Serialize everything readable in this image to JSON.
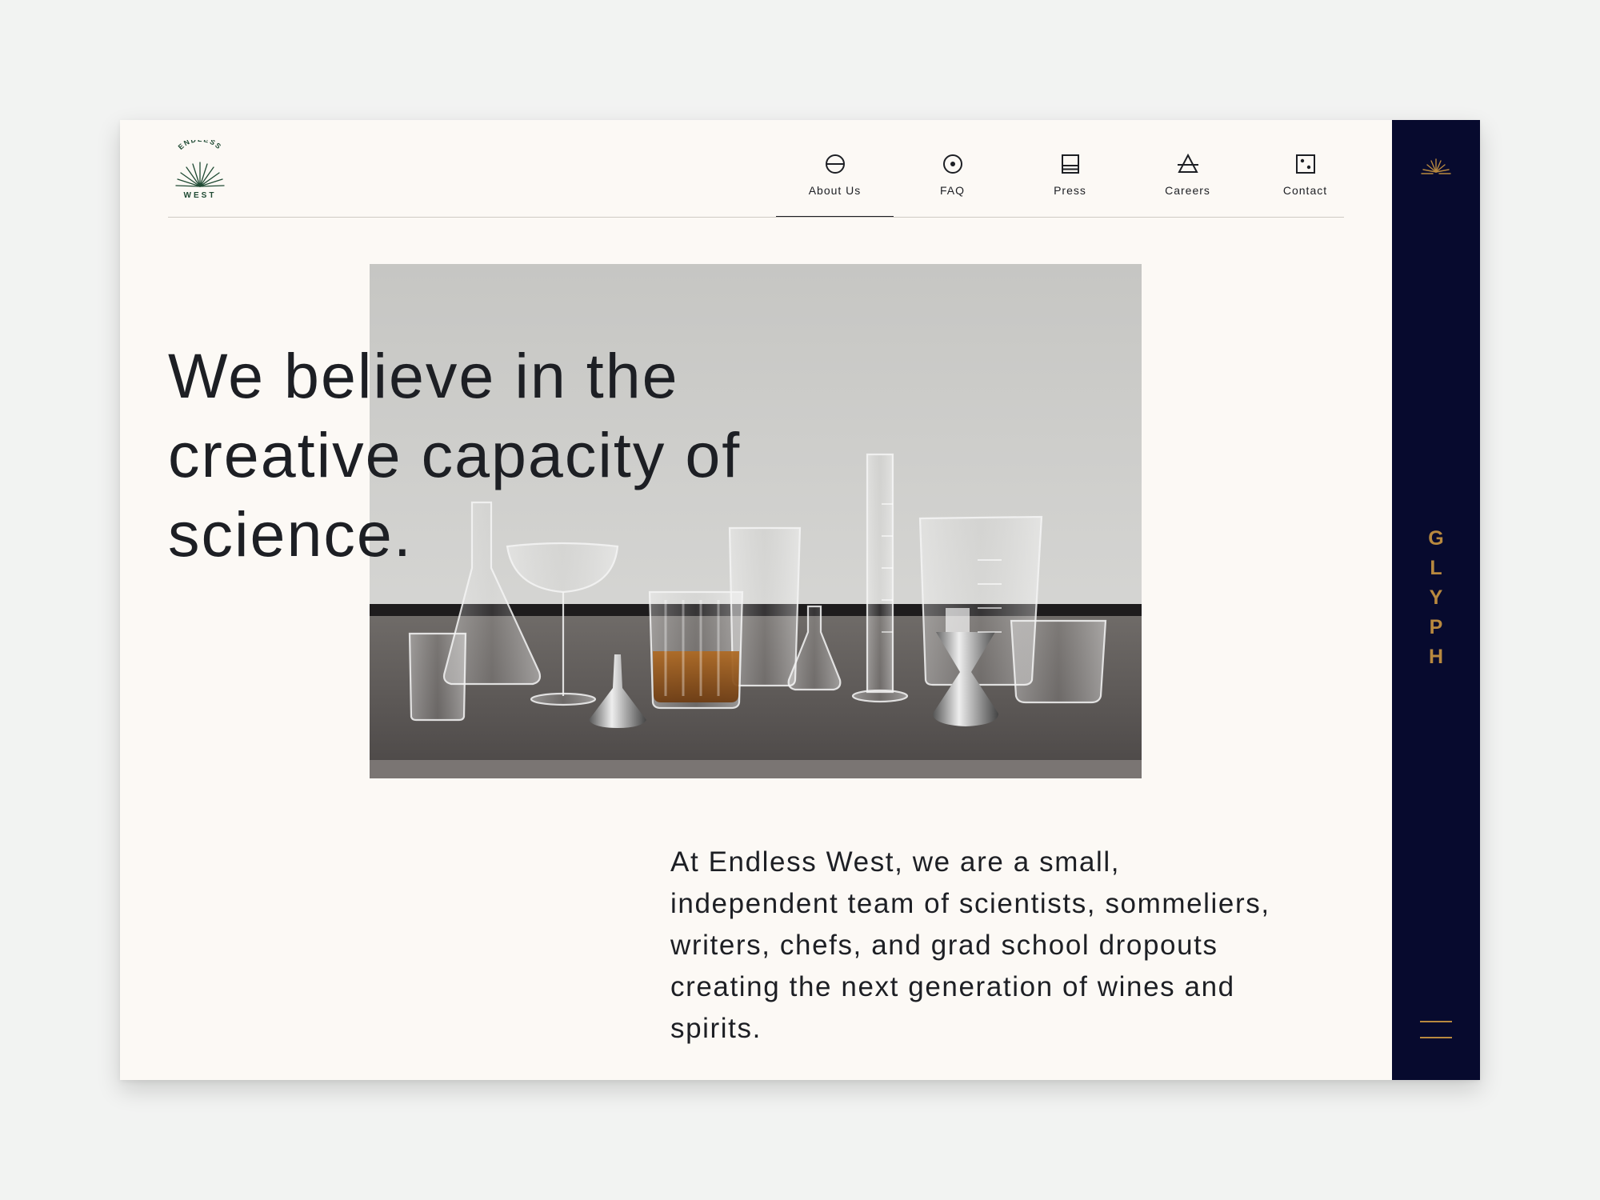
{
  "brand": {
    "logo_top_text": "ENDLESS",
    "logo_bottom_text": "WEST",
    "logo_color": "#1f4a33"
  },
  "nav": {
    "items": [
      {
        "label": "About Us",
        "icon": "circle-horizontal-line-icon",
        "active": true
      },
      {
        "label": "FAQ",
        "icon": "circle-dot-icon",
        "active": false
      },
      {
        "label": "Press",
        "icon": "square-lines-icon",
        "active": false
      },
      {
        "label": "Careers",
        "icon": "triangle-crossed-icon",
        "active": false
      },
      {
        "label": "Contact",
        "icon": "square-dots-icon",
        "active": false
      }
    ]
  },
  "hero": {
    "headline": "We believe in the creative capacity of science.",
    "image_subject": "laboratory-glassware-photo"
  },
  "body": {
    "text": "At Endless West, we are a small, independent team of scientists, sommeliers, writers, chefs, and grad school dropouts creating the next generation of wines and spirits."
  },
  "sidebar": {
    "brand_letters": [
      "G",
      "L",
      "Y",
      "P",
      "H"
    ],
    "background": "#070a2e",
    "accent": "#b8893f",
    "menu_icon": "hamburger-menu-icon",
    "logo_icon": "sunburst-icon"
  },
  "colors": {
    "page_background": "#f2f3f2",
    "content_background": "#fcf9f5",
    "text": "#1d1f24"
  }
}
